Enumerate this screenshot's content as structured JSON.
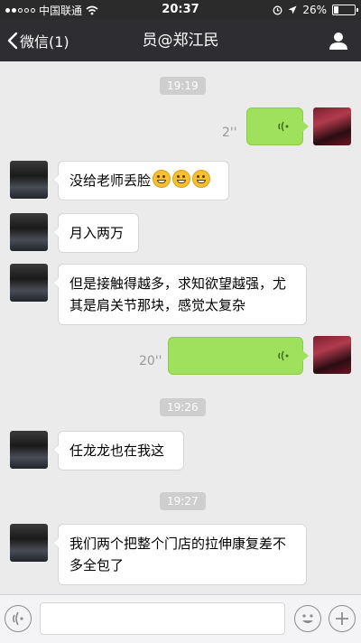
{
  "status_bar": {
    "carrier": "中国联通",
    "time": "20:37",
    "battery_percent": "26%",
    "battery_level": 0.26
  },
  "nav": {
    "back_label": "微信(1)",
    "title": "员@郑江民"
  },
  "messages": [
    {
      "type": "timestamp",
      "text": "19:19"
    },
    {
      "type": "voice",
      "sender": "me",
      "duration": "2''"
    },
    {
      "type": "text",
      "sender": "friend",
      "text": "没给老师丢脸",
      "emoji": [
        "grin-emoji",
        "grin-emoji",
        "grin-emoji"
      ]
    },
    {
      "type": "text",
      "sender": "friend",
      "text": "月入两万"
    },
    {
      "type": "text",
      "sender": "friend",
      "text": "但是接触得越多，求知欲望越强，尤其是肩关节那块，感觉太复杂"
    },
    {
      "type": "voice",
      "sender": "me",
      "duration": "20''"
    },
    {
      "type": "timestamp",
      "text": "19:26"
    },
    {
      "type": "text",
      "sender": "friend",
      "text": "任龙龙也在我这"
    },
    {
      "type": "timestamp",
      "text": "19:27"
    },
    {
      "type": "text",
      "sender": "friend",
      "text": "我们两个把整个门店的拉伸康复差不多全包了"
    }
  ],
  "colors": {
    "navbar": "#2e2e32",
    "background": "#ebebeb",
    "voice_bubble": "#9fe05c",
    "timestamp_bg": "#cecece"
  }
}
